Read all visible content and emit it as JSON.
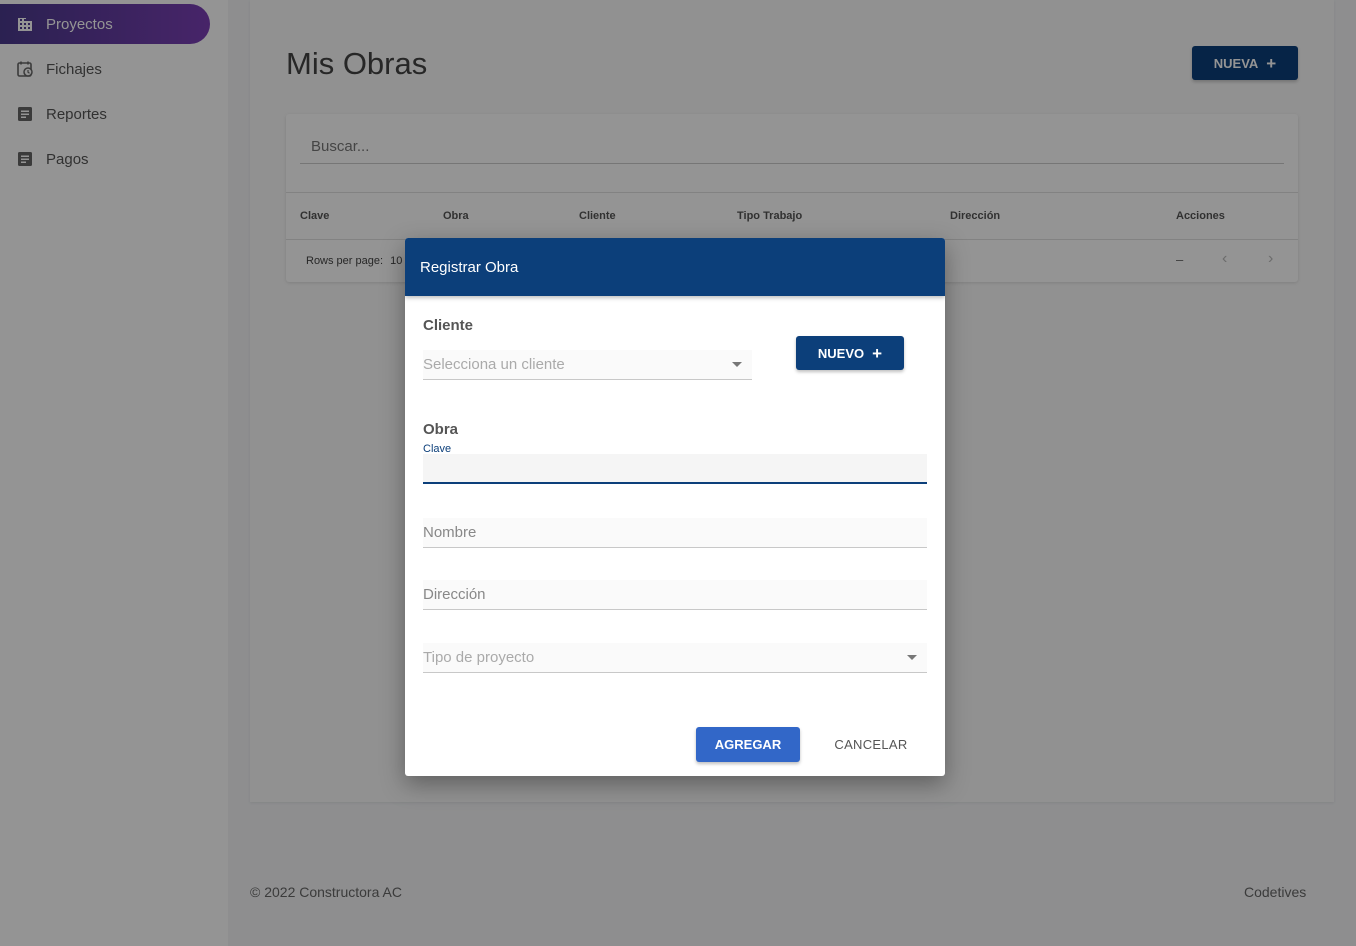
{
  "sidebar": {
    "items": [
      {
        "label": "Proyectos",
        "icon": "building-icon",
        "active": true
      },
      {
        "label": "Fichajes",
        "icon": "calendar-clock-icon",
        "active": false
      },
      {
        "label": "Reportes",
        "icon": "document-icon",
        "active": false
      },
      {
        "label": "Pagos",
        "icon": "document-icon",
        "active": false
      }
    ]
  },
  "main": {
    "title": "Mis Obras",
    "new_button": "NUEVA",
    "search_placeholder": "Buscar...",
    "columns": [
      "Clave",
      "Obra",
      "Cliente",
      "Tipo Trabajo",
      "Dirección",
      "Acciones"
    ],
    "rows_per_page_label": "Rows per page:",
    "rows_per_page_value": "10",
    "pagination_range": "–"
  },
  "footer": {
    "copyright": "© 2022 Constructora AC",
    "credit": "Codetives"
  },
  "dialog": {
    "title": "Registrar Obra",
    "cliente_section": "Cliente",
    "cliente_placeholder": "Selecciona un cliente",
    "new_client_button": "NUEVO",
    "obra_section": "Obra",
    "clave_label": "Clave",
    "clave_value": "",
    "nombre_placeholder": "Nombre",
    "direccion_placeholder": "Dirección",
    "tipo_placeholder": "Tipo de proyecto",
    "add_button": "AGREGAR",
    "cancel_button": "CANCELAR"
  },
  "colors": {
    "primary": "#0c3f7a",
    "accent_button": "#3267c8",
    "sidebar_active_gradient": [
      "#4a3a8c",
      "#7b3fb5"
    ]
  }
}
